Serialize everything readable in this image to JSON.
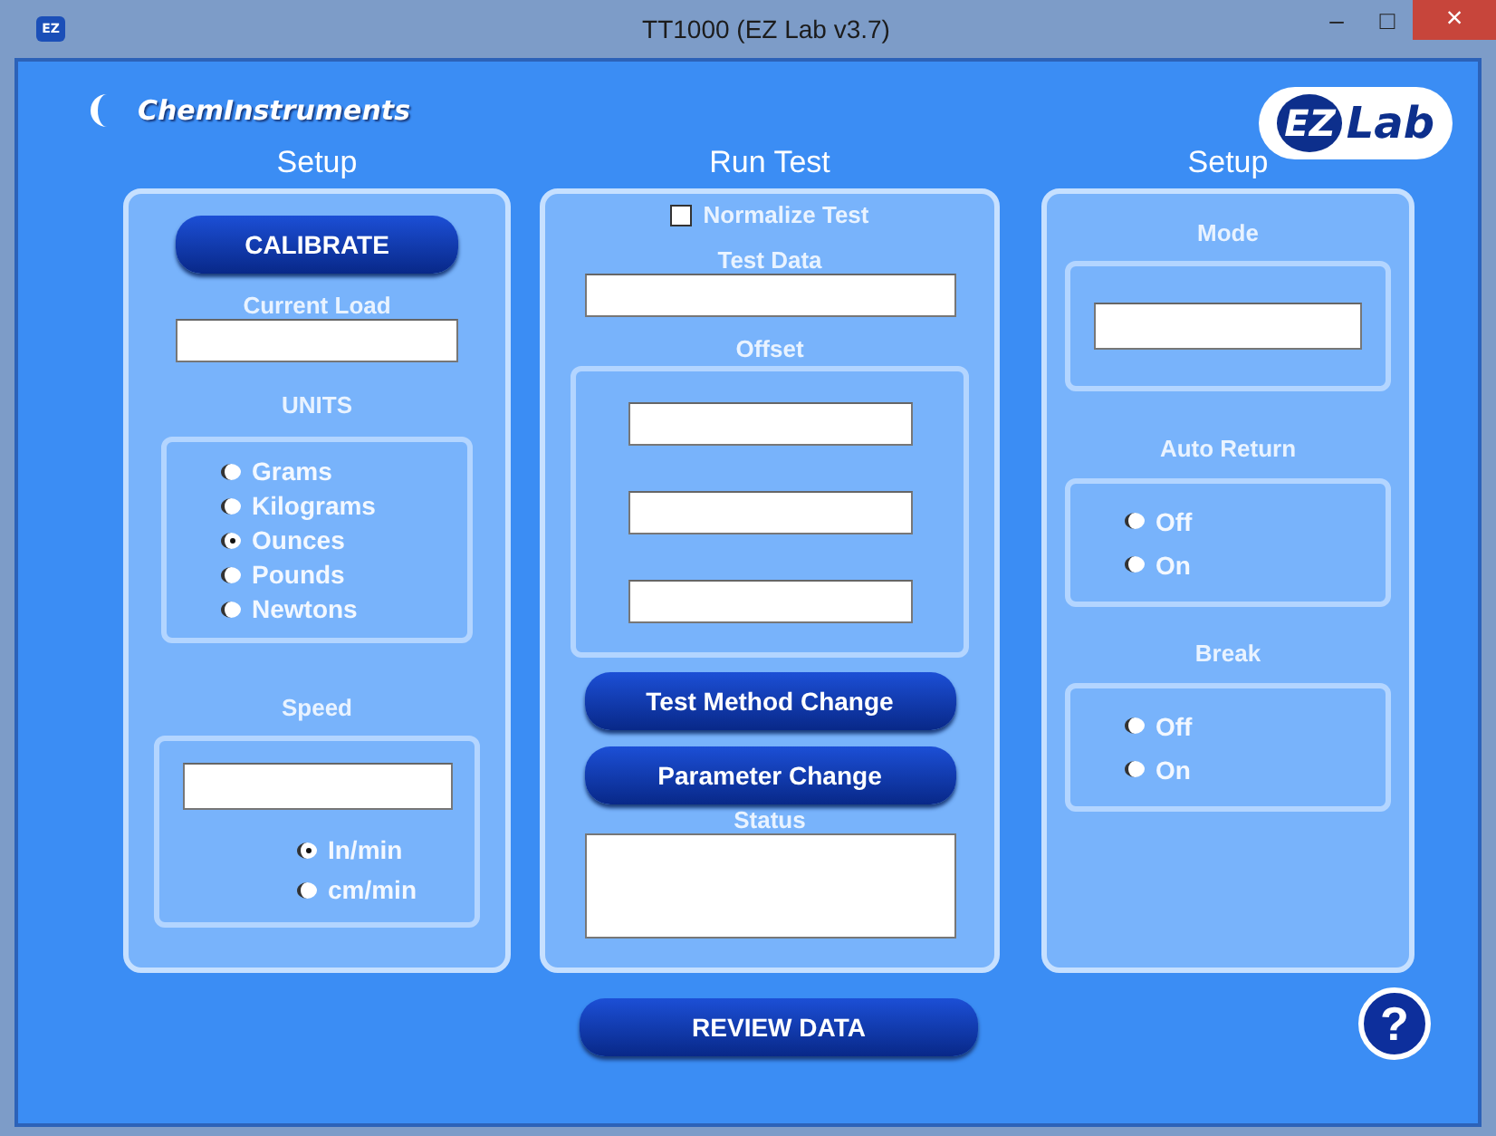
{
  "window": {
    "title": "TT1000 (EZ Lab v3.7)",
    "app_icon": "EZ",
    "minimize": "–",
    "maximize": "□",
    "close": "×"
  },
  "logos": {
    "left": "ChemInstruments",
    "right_ez": "EZ",
    "right_lab": "Lab"
  },
  "setup_left": {
    "heading": "Setup",
    "calibrate_button": "CALIBRATE",
    "current_load_label": "Current Load",
    "units": {
      "label": "UNITS",
      "options": [
        {
          "label": "Grams",
          "selected": false
        },
        {
          "label": "Kilograms",
          "selected": false
        },
        {
          "label": "Ounces",
          "selected": true
        },
        {
          "label": "Pounds",
          "selected": false
        },
        {
          "label": "Newtons",
          "selected": false
        }
      ]
    },
    "speed": {
      "label": "Speed",
      "options": [
        {
          "label": "In/min",
          "selected": true
        },
        {
          "label": "cm/min",
          "selected": false
        }
      ]
    }
  },
  "run_test": {
    "heading": "Run Test",
    "normalize": {
      "label": "Normalize Test",
      "checked": false
    },
    "test_data_label": "Test Data",
    "offset_label": "Offset",
    "buttons": [
      "Test Method Change",
      "Parameter Change"
    ],
    "status_label": "Status"
  },
  "setup_right": {
    "heading": "Setup",
    "mode_label": "Mode",
    "auto_return": {
      "label": "Auto Return",
      "options": [
        {
          "label": "Off",
          "selected": false
        },
        {
          "label": "On",
          "selected": false
        }
      ]
    },
    "break": {
      "label": "Break",
      "options": [
        {
          "label": "Off",
          "selected": false
        },
        {
          "label": "On",
          "selected": false
        }
      ]
    }
  },
  "review_button": "REVIEW DATA",
  "help": "?"
}
